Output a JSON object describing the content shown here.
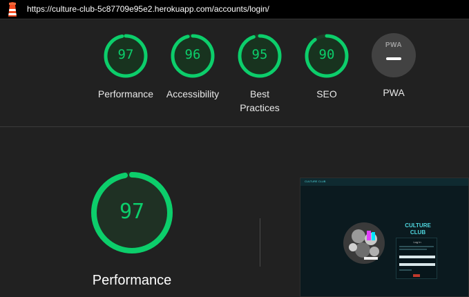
{
  "topbar": {
    "logo_icon": "lighthouse-icon",
    "url": "https://culture-club-5c87709e95e2.herokuapp.com/accounts/login/"
  },
  "colors": {
    "pass": "#0cce6b",
    "background": "#212121",
    "topbar": "#000000"
  },
  "scores": [
    {
      "value": 97,
      "label": "Performance"
    },
    {
      "value": 96,
      "label": "Accessibility"
    },
    {
      "value": 95,
      "label": "Best\nPractices"
    },
    {
      "value": 90,
      "label": "SEO"
    }
  ],
  "pwa": {
    "badge_text": "PWA",
    "label": "PWA",
    "icon": "pwa-badge-icon"
  },
  "performance": {
    "value": 97,
    "label": "Performance"
  },
  "screenshot": {
    "brand": "CULTURE CLUB",
    "form_title": "Log In"
  }
}
